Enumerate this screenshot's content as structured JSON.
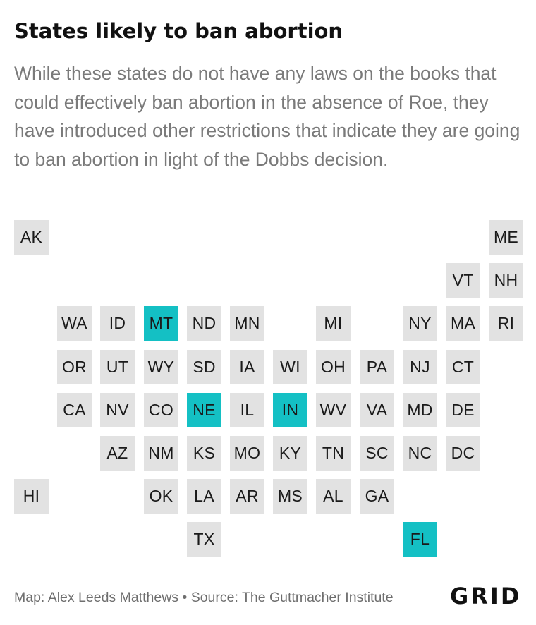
{
  "title": "States likely to ban abortion",
  "subtitle": "While these states do not have any laws on the books that could effectively ban abortion in the absence of Roe, they have introduced other restrictions that indicate they are going to ban abortion in light of the Dobbs decision.",
  "footer": {
    "credit": "Map: Alex Leeds Matthews • Source: The Guttmacher Institute",
    "logo": "GRID"
  },
  "colors": {
    "highlight": "#14c0c4",
    "default_tile": "#e2e2e2"
  },
  "states": [
    {
      "abbr": "AK",
      "row": 0,
      "col": 0,
      "highlighted": false
    },
    {
      "abbr": "ME",
      "row": 0,
      "col": 11,
      "highlighted": false
    },
    {
      "abbr": "VT",
      "row": 1,
      "col": 10,
      "highlighted": false
    },
    {
      "abbr": "NH",
      "row": 1,
      "col": 11,
      "highlighted": false
    },
    {
      "abbr": "WA",
      "row": 2,
      "col": 1,
      "highlighted": false
    },
    {
      "abbr": "ID",
      "row": 2,
      "col": 2,
      "highlighted": false
    },
    {
      "abbr": "MT",
      "row": 2,
      "col": 3,
      "highlighted": true
    },
    {
      "abbr": "ND",
      "row": 2,
      "col": 4,
      "highlighted": false
    },
    {
      "abbr": "MN",
      "row": 2,
      "col": 5,
      "highlighted": false
    },
    {
      "abbr": "MI",
      "row": 2,
      "col": 7,
      "highlighted": false
    },
    {
      "abbr": "NY",
      "row": 2,
      "col": 9,
      "highlighted": false
    },
    {
      "abbr": "MA",
      "row": 2,
      "col": 10,
      "highlighted": false
    },
    {
      "abbr": "RI",
      "row": 2,
      "col": 11,
      "highlighted": false
    },
    {
      "abbr": "OR",
      "row": 3,
      "col": 1,
      "highlighted": false
    },
    {
      "abbr": "UT",
      "row": 3,
      "col": 2,
      "highlighted": false
    },
    {
      "abbr": "WY",
      "row": 3,
      "col": 3,
      "highlighted": false
    },
    {
      "abbr": "SD",
      "row": 3,
      "col": 4,
      "highlighted": false
    },
    {
      "abbr": "IA",
      "row": 3,
      "col": 5,
      "highlighted": false
    },
    {
      "abbr": "WI",
      "row": 3,
      "col": 6,
      "highlighted": false
    },
    {
      "abbr": "OH",
      "row": 3,
      "col": 7,
      "highlighted": false
    },
    {
      "abbr": "PA",
      "row": 3,
      "col": 8,
      "highlighted": false
    },
    {
      "abbr": "NJ",
      "row": 3,
      "col": 9,
      "highlighted": false
    },
    {
      "abbr": "CT",
      "row": 3,
      "col": 10,
      "highlighted": false
    },
    {
      "abbr": "CA",
      "row": 4,
      "col": 1,
      "highlighted": false
    },
    {
      "abbr": "NV",
      "row": 4,
      "col": 2,
      "highlighted": false
    },
    {
      "abbr": "CO",
      "row": 4,
      "col": 3,
      "highlighted": false
    },
    {
      "abbr": "NE",
      "row": 4,
      "col": 4,
      "highlighted": true
    },
    {
      "abbr": "IL",
      "row": 4,
      "col": 5,
      "highlighted": false
    },
    {
      "abbr": "IN",
      "row": 4,
      "col": 6,
      "highlighted": true
    },
    {
      "abbr": "WV",
      "row": 4,
      "col": 7,
      "highlighted": false
    },
    {
      "abbr": "VA",
      "row": 4,
      "col": 8,
      "highlighted": false
    },
    {
      "abbr": "MD",
      "row": 4,
      "col": 9,
      "highlighted": false
    },
    {
      "abbr": "DE",
      "row": 4,
      "col": 10,
      "highlighted": false
    },
    {
      "abbr": "AZ",
      "row": 5,
      "col": 2,
      "highlighted": false
    },
    {
      "abbr": "NM",
      "row": 5,
      "col": 3,
      "highlighted": false
    },
    {
      "abbr": "KS",
      "row": 5,
      "col": 4,
      "highlighted": false
    },
    {
      "abbr": "MO",
      "row": 5,
      "col": 5,
      "highlighted": false
    },
    {
      "abbr": "KY",
      "row": 5,
      "col": 6,
      "highlighted": false
    },
    {
      "abbr": "TN",
      "row": 5,
      "col": 7,
      "highlighted": false
    },
    {
      "abbr": "SC",
      "row": 5,
      "col": 8,
      "highlighted": false
    },
    {
      "abbr": "NC",
      "row": 5,
      "col": 9,
      "highlighted": false
    },
    {
      "abbr": "DC",
      "row": 5,
      "col": 10,
      "highlighted": false
    },
    {
      "abbr": "HI",
      "row": 6,
      "col": 0,
      "highlighted": false
    },
    {
      "abbr": "OK",
      "row": 6,
      "col": 3,
      "highlighted": false
    },
    {
      "abbr": "LA",
      "row": 6,
      "col": 4,
      "highlighted": false
    },
    {
      "abbr": "AR",
      "row": 6,
      "col": 5,
      "highlighted": false
    },
    {
      "abbr": "MS",
      "row": 6,
      "col": 6,
      "highlighted": false
    },
    {
      "abbr": "AL",
      "row": 6,
      "col": 7,
      "highlighted": false
    },
    {
      "abbr": "GA",
      "row": 6,
      "col": 8,
      "highlighted": false
    },
    {
      "abbr": "TX",
      "row": 7,
      "col": 4,
      "highlighted": false
    },
    {
      "abbr": "FL",
      "row": 7,
      "col": 9,
      "highlighted": true
    }
  ]
}
